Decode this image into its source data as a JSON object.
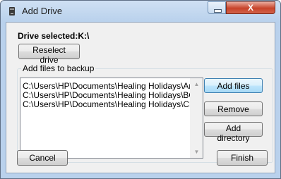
{
  "window": {
    "title": "Add Drive",
    "close_glyph": "X"
  },
  "drive": {
    "label": "Drive selected:K:\\",
    "reselect_label": "Reselect drive"
  },
  "files": {
    "group_title": "Add files to backup",
    "items": [
      "C:\\Users\\HP\\Documents\\Healing Holidays\\Arca",
      "C:\\Users\\HP\\Documents\\Healing Holidays\\BOL",
      "C:\\Users\\HP\\Documents\\Healing Holidays\\Chal"
    ],
    "add_files_label": "Add files",
    "remove_label": "Remove",
    "add_directory_label": "Add directory"
  },
  "footer": {
    "cancel_label": "Cancel",
    "finish_label": "Finish"
  },
  "icons": {
    "app": "drive-icon",
    "scroll_up": "triangle-up-icon",
    "scroll_down": "triangle-down-icon"
  }
}
